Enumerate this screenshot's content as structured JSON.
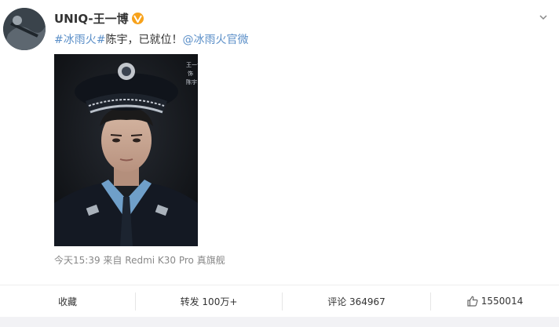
{
  "post": {
    "username": "UNIQ-王一博",
    "text_parts": {
      "hashtag": "#冰雨火#",
      "body": "陈宇，已就位！",
      "mention": "@冰雨火官微"
    },
    "image": {
      "caption_lines": [
        "王一博",
        "饰",
        "陈宇"
      ]
    },
    "meta": {
      "time": "今天15:39",
      "source_prefix": "来自",
      "source_device": "Redmi K30 Pro 真旗舰"
    }
  },
  "actions": {
    "favorite": "收藏",
    "repost": "转发 100万+",
    "comment": "评论 364967",
    "like_count": "1550014"
  },
  "icons": {
    "verified": "verified-badge-icon",
    "menu": "chevron-down-icon",
    "like": "thumbs-up-icon"
  },
  "colors": {
    "link": "#5b8fc8",
    "verified_badge": "#f7a21b",
    "meta_text": "#888888"
  }
}
